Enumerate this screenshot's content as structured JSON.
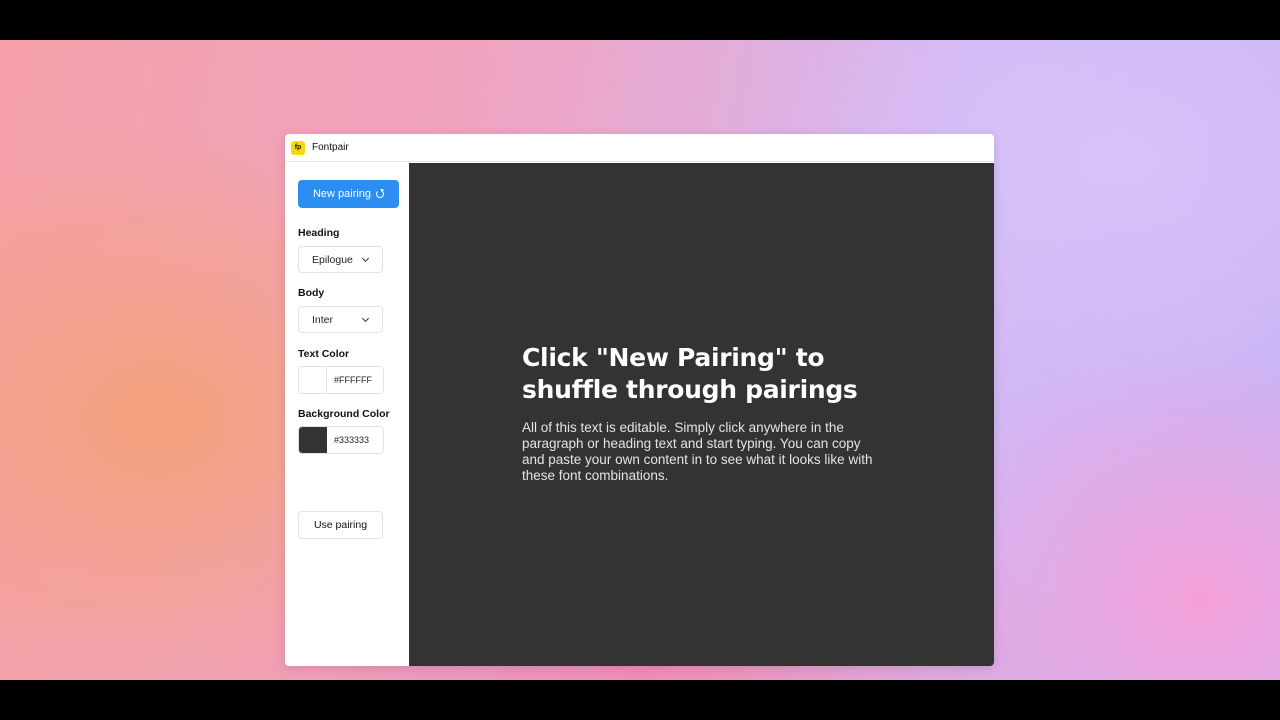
{
  "app": {
    "title": "Fontpair",
    "logo_text": "fp",
    "logo_color": "#f5d90a"
  },
  "sidebar": {
    "new_pairing_label": "New pairing",
    "new_pairing_icon": "refresh-icon",
    "heading": {
      "label": "Heading",
      "value": "Epilogue"
    },
    "body": {
      "label": "Body",
      "value": "Inter"
    },
    "text_color": {
      "label": "Text Color",
      "value": "#FFFFFF",
      "swatch": "#ffffff"
    },
    "background_color": {
      "label": "Background Color",
      "value": "#333333",
      "swatch": "#333333"
    },
    "use_pairing_label": "Use pairing"
  },
  "preview": {
    "heading": "Click \"New Pairing\" to shuffle through pairings",
    "body": "All of this text is editable. Simply click anywhere in the paragraph or heading text and start typing. You can copy and paste your own content in to see what it looks like with these font combinations."
  },
  "colors": {
    "accent": "#2b8ef0",
    "canvas_bg": "#333333",
    "canvas_text": "#ffffff"
  }
}
